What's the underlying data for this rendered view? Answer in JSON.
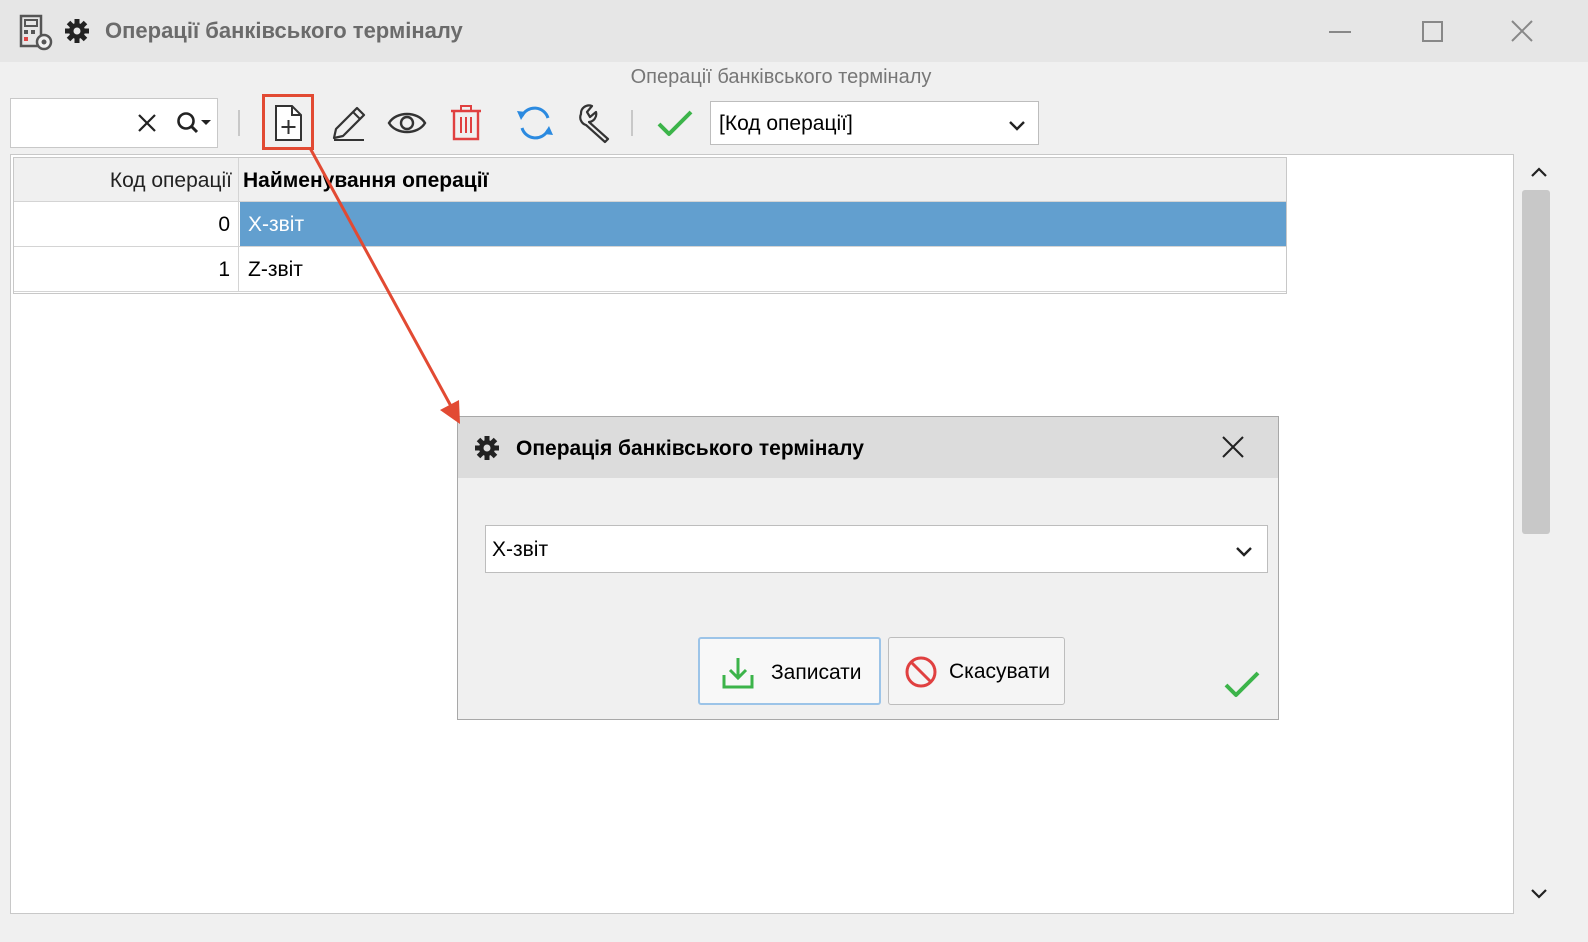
{
  "window": {
    "title": "Операції банківського терміналу",
    "subtitle": "Операції банківського терміналу"
  },
  "toolbar": {
    "search_value": "",
    "sort_field": "[Код операції]",
    "buttons": [
      "new-document-icon",
      "edit-pencil-icon",
      "view-eye-icon",
      "delete-trash-icon",
      "refresh-icon",
      "settings-wrench-icon",
      "apply-check-icon"
    ]
  },
  "table": {
    "columns": [
      "Код операції",
      "Найменування операції"
    ],
    "rows": [
      {
        "code": "0",
        "name": "X-звіт",
        "selected": true
      },
      {
        "code": "1",
        "name": "Z-звіт",
        "selected": false
      }
    ]
  },
  "dialog": {
    "title": "Операція банківського терміналу",
    "selected_value": "X-звіт",
    "save_label": "Записати",
    "cancel_label": "Скасувати"
  },
  "colors": {
    "selection": "#629fcf",
    "highlight": "#e24a33",
    "check_green": "#3cb44a",
    "refresh_blue": "#2b8ae0",
    "delete_red": "#e04040"
  }
}
